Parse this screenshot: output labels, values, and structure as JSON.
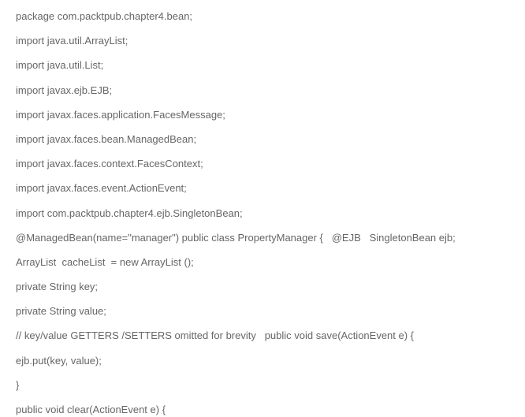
{
  "code": {
    "lines": [
      "package com.packtpub.chapter4.bean;",
      "import java.util.ArrayList;",
      "import java.util.List;",
      "import javax.ejb.EJB;",
      "import javax.faces.application.FacesMessage;",
      "import javax.faces.bean.ManagedBean;",
      "import javax.faces.context.FacesContext;",
      "import javax.faces.event.ActionEvent;",
      "import com.packtpub.chapter4.ejb.SingletonBean;",
      "@ManagedBean(name=\"manager\") public class PropertyManager {   @EJB   SingletonBean ejb;",
      "ArrayList  cacheList  = new ArrayList ();",
      "private String key;",
      "private String value;",
      "// key/value GETTERS /SETTERS omitted for brevity   public void save(ActionEvent e) {",
      "ejb.put(key, value);",
      "}",
      "public void clear(ActionEvent e) {"
    ]
  }
}
